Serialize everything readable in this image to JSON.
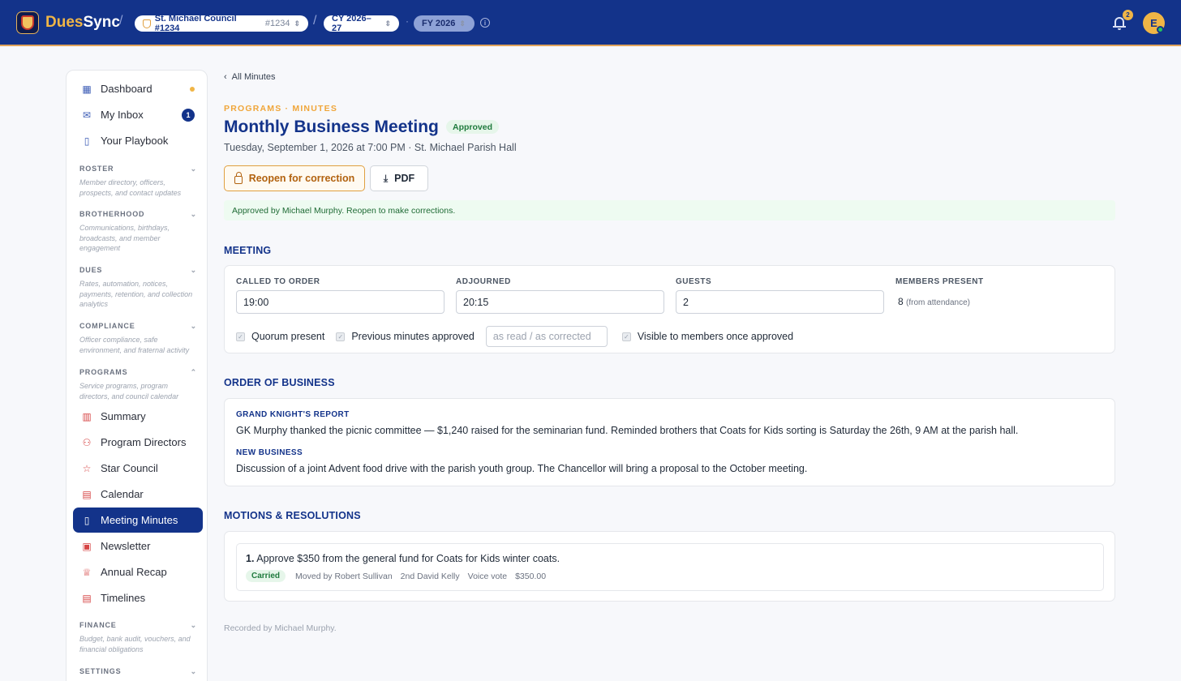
{
  "header": {
    "brand_a": "Dues",
    "brand_b": "Sync",
    "council": "St. Michael Council #1234",
    "council_no": "#1234",
    "calendar_year": "CY 2026–27",
    "fiscal_year": "FY 2026",
    "notifications": "2",
    "avatar_initial": "E",
    "separator": "/",
    "dot": "·"
  },
  "sidebar": {
    "top_items": [
      {
        "label": "Dashboard",
        "icon": "grid-icon"
      },
      {
        "label": "My Inbox",
        "icon": "inbox-icon",
        "badge": "1"
      },
      {
        "label": "Your Playbook",
        "icon": "book-icon"
      }
    ],
    "sections": [
      {
        "title": "ROSTER",
        "desc": "Member directory, officers, prospects, and contact updates"
      },
      {
        "title": "BROTHERHOOD",
        "desc": "Communications, birthdays, broadcasts, and member engagement"
      },
      {
        "title": "DUES",
        "desc": "Rates, automation, notices, payments, retention, and collection analytics"
      },
      {
        "title": "COMPLIANCE",
        "desc": "Officer compliance, safe environment, and fraternal activity"
      },
      {
        "title": "PROGRAMS",
        "desc": "Service programs, program directors, and council calendar"
      },
      {
        "title": "FINANCE",
        "desc": "Budget, bank audit, vouchers, and financial obligations"
      },
      {
        "title": "SETTINGS",
        "desc": ""
      }
    ],
    "program_items": [
      {
        "label": "Summary",
        "icon": "bar-chart-icon"
      },
      {
        "label": "Program Directors",
        "icon": "people-icon"
      },
      {
        "label": "Star Council",
        "icon": "star-icon"
      },
      {
        "label": "Calendar",
        "icon": "calendar-icon"
      },
      {
        "label": "Meeting Minutes",
        "icon": "book-icon",
        "active": true
      },
      {
        "label": "Newsletter",
        "icon": "newspaper-icon"
      },
      {
        "label": "Annual Recap",
        "icon": "trophy-icon"
      },
      {
        "label": "Timelines",
        "icon": "calendar-icon"
      }
    ]
  },
  "page": {
    "back_label": "All Minutes",
    "eyebrow": "PROGRAMS · MINUTES",
    "title": "Monthly Business Meeting",
    "status": "Approved",
    "subtitle": "Tuesday, September 1, 2026 at 7:00 PM · St. Michael Parish Hall",
    "reopen_label": "Reopen for correction",
    "pdf_label": "PDF",
    "notice": "Approved by Michael Murphy. Reopen to make corrections.",
    "recorded": "Recorded by Michael Murphy."
  },
  "meeting": {
    "heading": "MEETING",
    "called_label": "CALLED TO ORDER",
    "called_value": "19:00",
    "adjourned_label": "ADJOURNED",
    "adjourned_value": "20:15",
    "guests_label": "GUESTS",
    "guests_value": "2",
    "members_label": "MEMBERS PRESENT",
    "members_value": "8",
    "members_note": "(from attendance)",
    "quorum_label": "Quorum present",
    "prev_label": "Previous minutes approved",
    "prev_placeholder": "as read / as corrected",
    "visible_label": "Visible to members once approved"
  },
  "order_of_business": {
    "heading": "ORDER OF BUSINESS",
    "items": [
      {
        "title": "GRAND KNIGHT'S REPORT",
        "text": "GK Murphy thanked the picnic committee — $1,240 raised for the seminarian fund. Reminded brothers that Coats for Kids sorting is Saturday the 26th, 9 AM at the parish hall."
      },
      {
        "title": "NEW BUSINESS",
        "text": "Discussion of a joint Advent food drive with the parish youth group. The Chancellor will bring a proposal to the October meeting."
      }
    ]
  },
  "motions": {
    "heading": "MOTIONS & RESOLUTIONS",
    "items": [
      {
        "number": "1.",
        "text": "Approve $350 from the general fund for Coats for Kids winter coats.",
        "result": "Carried",
        "moved": "Moved by Robert Sullivan",
        "second": "2nd David Kelly",
        "vote": "Voice vote",
        "amount": "$350.00"
      }
    ]
  }
}
